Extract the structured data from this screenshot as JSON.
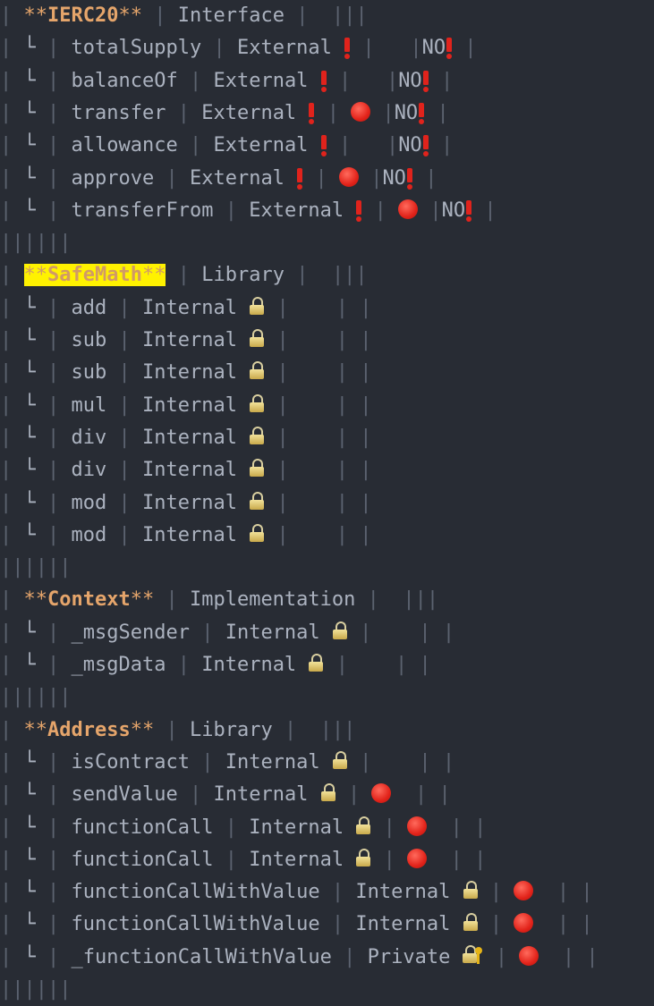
{
  "glyphs": {
    "pipe": "|",
    "branch": "└",
    "separator": "||||||"
  },
  "icons": {
    "warning": "exclamation-icon",
    "stop": "stop-sign-icon",
    "internal": "lock-icon",
    "private": "lock-with-key-icon"
  },
  "colors": {
    "background": "#282c34",
    "text": "#abb2bf",
    "pipe": "#5c6370",
    "bold": "#e5a56b",
    "highlight": "#fff200",
    "stop": "#e2231a",
    "warning": "#e0231c"
  },
  "lines": [
    {
      "type": "contract",
      "name": "IERC20",
      "kind": "Interface",
      "highlight": false
    },
    {
      "type": "fn",
      "name": "totalSupply",
      "vis": "External",
      "vis_icon": "warn",
      "mod": "",
      "cells": "|NO",
      "tail": "warn",
      "end": " |"
    },
    {
      "type": "fn",
      "name": "balanceOf",
      "vis": "External",
      "vis_icon": "warn",
      "mod": "",
      "cells": "|NO",
      "tail": "warn",
      "end": " |"
    },
    {
      "type": "fn",
      "name": "transfer",
      "vis": "External",
      "vis_icon": "warn",
      "mod": "stop",
      "cells": "|NO",
      "tail": "warn",
      "end": " |"
    },
    {
      "type": "fn",
      "name": "allowance",
      "vis": "External",
      "vis_icon": "warn",
      "mod": "",
      "cells": "|NO",
      "tail": "warn",
      "end": " |"
    },
    {
      "type": "fn",
      "name": "approve",
      "vis": "External",
      "vis_icon": "warn",
      "mod": "stop",
      "cells": "|NO",
      "tail": "warn",
      "end": " |"
    },
    {
      "type": "fn",
      "name": "transferFrom",
      "vis": "External",
      "vis_icon": "warn",
      "mod": "stop",
      "cells": "|NO",
      "tail": "warn",
      "end": " |"
    },
    {
      "type": "sep",
      "text": "||||||"
    },
    {
      "type": "contract",
      "name": "SafeMath",
      "kind": "Library",
      "highlight": true
    },
    {
      "type": "fn",
      "name": "add",
      "vis": "Internal",
      "vis_icon": "lock",
      "mod": "",
      "cells": "|",
      "tail": "",
      "end": " |"
    },
    {
      "type": "fn",
      "name": "sub",
      "vis": "Internal",
      "vis_icon": "lock",
      "mod": "",
      "cells": "|",
      "tail": "",
      "end": " |"
    },
    {
      "type": "fn",
      "name": "sub",
      "vis": "Internal",
      "vis_icon": "lock",
      "mod": "",
      "cells": "|",
      "tail": "",
      "end": " |"
    },
    {
      "type": "fn",
      "name": "mul",
      "vis": "Internal",
      "vis_icon": "lock",
      "mod": "",
      "cells": "|",
      "tail": "",
      "end": " |"
    },
    {
      "type": "fn",
      "name": "div",
      "vis": "Internal",
      "vis_icon": "lock",
      "mod": "",
      "cells": "|",
      "tail": "",
      "end": " |"
    },
    {
      "type": "fn",
      "name": "div",
      "vis": "Internal",
      "vis_icon": "lock",
      "mod": "",
      "cells": "|",
      "tail": "",
      "end": " |"
    },
    {
      "type": "fn",
      "name": "mod",
      "vis": "Internal",
      "vis_icon": "lock",
      "mod": "",
      "cells": "|",
      "tail": "",
      "end": " |"
    },
    {
      "type": "fn",
      "name": "mod",
      "vis": "Internal",
      "vis_icon": "lock",
      "mod": "",
      "cells": "|",
      "tail": "",
      "end": " |"
    },
    {
      "type": "sep",
      "text": "||||||"
    },
    {
      "type": "contract",
      "name": "Context",
      "kind": "Implementation",
      "highlight": false
    },
    {
      "type": "fn",
      "name": "_msgSender",
      "vis": "Internal",
      "vis_icon": "lock",
      "mod": "",
      "cells": "|",
      "tail": "",
      "end": " |"
    },
    {
      "type": "fn",
      "name": "_msgData",
      "vis": "Internal",
      "vis_icon": "lock",
      "mod": "",
      "cells": "|",
      "tail": "",
      "end": " |"
    },
    {
      "type": "sep",
      "text": "||||||"
    },
    {
      "type": "contract",
      "name": "Address",
      "kind": "Library",
      "highlight": false
    },
    {
      "type": "fn",
      "name": "isContract",
      "vis": "Internal",
      "vis_icon": "lock",
      "mod": "",
      "cells": "|",
      "tail": "",
      "end": " |"
    },
    {
      "type": "fn",
      "name": "sendValue",
      "vis": "Internal",
      "vis_icon": "lock",
      "mod": "stop",
      "cells": "|",
      "tail": "",
      "end": " |"
    },
    {
      "type": "fn",
      "name": "functionCall",
      "vis": "Internal",
      "vis_icon": "lock",
      "mod": "stop",
      "cells": "|",
      "tail": "",
      "end": " |"
    },
    {
      "type": "fn",
      "name": "functionCall",
      "vis": "Internal",
      "vis_icon": "lock",
      "mod": "stop",
      "cells": "|",
      "tail": "",
      "end": " |"
    },
    {
      "type": "fn",
      "name": "functionCallWithValue",
      "vis": "Internal",
      "vis_icon": "lock",
      "mod": "stop",
      "cells": "|",
      "tail": "",
      "end": " |"
    },
    {
      "type": "fn",
      "name": "functionCallWithValue",
      "vis": "Internal",
      "vis_icon": "lock",
      "mod": "stop",
      "cells": "|",
      "tail": "",
      "end": " |"
    },
    {
      "type": "fn",
      "name": "_functionCallWithValue",
      "vis": "Private",
      "vis_icon": "lockkey",
      "mod": "stop",
      "cells": "|",
      "tail": "",
      "end": " |"
    },
    {
      "type": "sep",
      "text": "||||||"
    }
  ]
}
